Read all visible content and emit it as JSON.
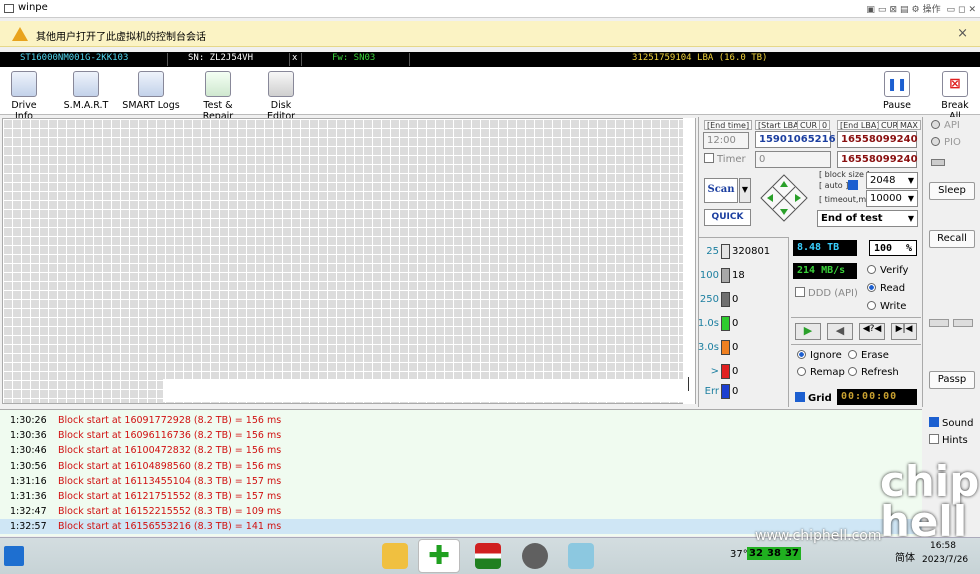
{
  "window": {
    "title": "winpe",
    "controls": "操作"
  },
  "warning": {
    "text": "其他用户打开了此虚拟机的控制台会话",
    "close": "×"
  },
  "drive": {
    "model": "ST16000NM001G-2KK103",
    "serial": "SN: ZL2J54VH",
    "sep": "x",
    "firmware": "Fw: SN03",
    "lba": "31251759104 LBA (16.0 TB)"
  },
  "toolbar": {
    "drive_info": "Drive Info",
    "smart": "S.M.A.R.T",
    "smart_logs": "SMART Logs",
    "test_repair": "Test & Repair",
    "disk_editor": "Disk Editor",
    "pause": "Pause",
    "break_all": "Break All"
  },
  "settings": {
    "end_time_label": "[End time]",
    "end_time": "12:00",
    "timer": "Timer",
    "timer_value": "0",
    "start_lba_label": "[Start LBA]",
    "start_lba": "15901065216",
    "cur": "CUR",
    "zero": "0",
    "end_lba_label": "[End LBA]",
    "end_lba": "16558099240",
    "end_lba2": "16558099240",
    "max": "MAX",
    "scan": "Scan",
    "quick": "QUICK",
    "block_size_label": "[ block size ]",
    "auto_label": "[ auto ]",
    "block_size": "2048",
    "timeout_label": "[ timeout,ms ]",
    "timeout": "10000",
    "end_action": "End of test"
  },
  "stats": {
    "items": [
      {
        "label": "25",
        "count": "320801",
        "color": "#e4e4e4"
      },
      {
        "label": "100",
        "count": "18",
        "color": "#a8a8a8"
      },
      {
        "label": "250",
        "count": "0",
        "color": "#707070"
      },
      {
        "label": "1.0s",
        "count": "0",
        "color": "#2ecc2e"
      },
      {
        "label": "3.0s",
        "count": "0",
        "color": "#f08020"
      },
      {
        "label": ">",
        "count": "0",
        "color": "#e02020"
      },
      {
        "label": "Err",
        "count": "0",
        "color": "#1c3fd0"
      }
    ],
    "size": "8.48 TB",
    "percent": "100",
    "pct": "%",
    "speed": "214 MB/s",
    "ddd": "DDD (API)",
    "verify": "Verify",
    "read": "Read",
    "write": "Write",
    "ignore": "Ignore",
    "erase": "Erase",
    "remap": "Remap",
    "refresh": "Refresh",
    "grid": "Grid",
    "clock": "00:00:00"
  },
  "side": {
    "api": "API",
    "pio": "PIO",
    "sleep": "Sleep",
    "recall": "Recall",
    "passp": "Passp",
    "sound": "Sound",
    "hints": "Hints"
  },
  "log": [
    {
      "t": "1:30:26",
      "m": "Block start at 16091772928 (8.2 TB)  = 156 ms"
    },
    {
      "t": "1:30:36",
      "m": "Block start at 16096116736 (8.2 TB)  = 156 ms"
    },
    {
      "t": "1:30:46",
      "m": "Block start at 16100472832 (8.2 TB)  = 156 ms"
    },
    {
      "t": "1:30:56",
      "m": "Block start at 16104898560 (8.2 TB)  = 156 ms"
    },
    {
      "t": "1:31:16",
      "m": "Block start at 16113455104 (8.3 TB)  = 157 ms"
    },
    {
      "t": "1:31:36",
      "m": "Block start at 16121751552 (8.3 TB)  = 157 ms"
    },
    {
      "t": "1:32:47",
      "m": "Block start at 16152215552 (8.3 TB)  = 109 ms"
    },
    {
      "t": "1:32:57",
      "m": "Block start at 16156553216 (8.3 TB)  = 141 ms"
    }
  ],
  "taskbar": {
    "temp": "37°",
    "n1": "32",
    "n2": "38",
    "n3": "37",
    "ime": "简体",
    "time": "16:58",
    "date": "2023/7/26"
  },
  "watermark": "www.chiphell.com",
  "logo": "chip hell"
}
